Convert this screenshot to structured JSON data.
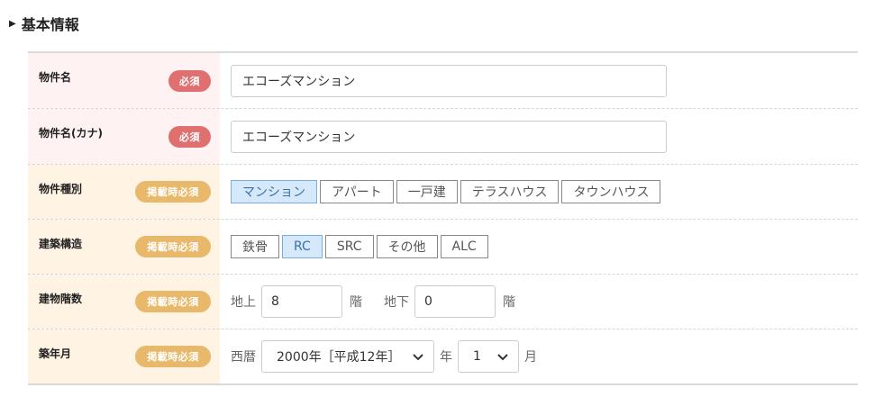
{
  "section": {
    "title": "基本情報"
  },
  "badges": {
    "required": "必須",
    "publish_required": "掲載時必須"
  },
  "fields": {
    "name": {
      "label": "物件名",
      "value": "エコーズマンション"
    },
    "name_kana": {
      "label": "物件名(カナ)",
      "value": "エコーズマンション"
    },
    "type": {
      "label": "物件種別",
      "options": [
        "マンション",
        "アパート",
        "一戸建",
        "テラスハウス",
        "タウンハウス"
      ],
      "selected": "マンション"
    },
    "structure": {
      "label": "建築構造",
      "options": [
        "鉄骨",
        "RC",
        "SRC",
        "その他",
        "ALC"
      ],
      "selected": "RC"
    },
    "floors": {
      "label": "建物階数",
      "above_label": "地上",
      "above_value": "8",
      "above_unit": "階",
      "below_label": "地下",
      "below_value": "0",
      "below_unit": "階"
    },
    "built": {
      "label": "築年月",
      "era_label": "西暦",
      "year_value": "2000年［平成12年］",
      "year_unit": "年",
      "month_value": "1",
      "month_unit": "月"
    }
  }
}
